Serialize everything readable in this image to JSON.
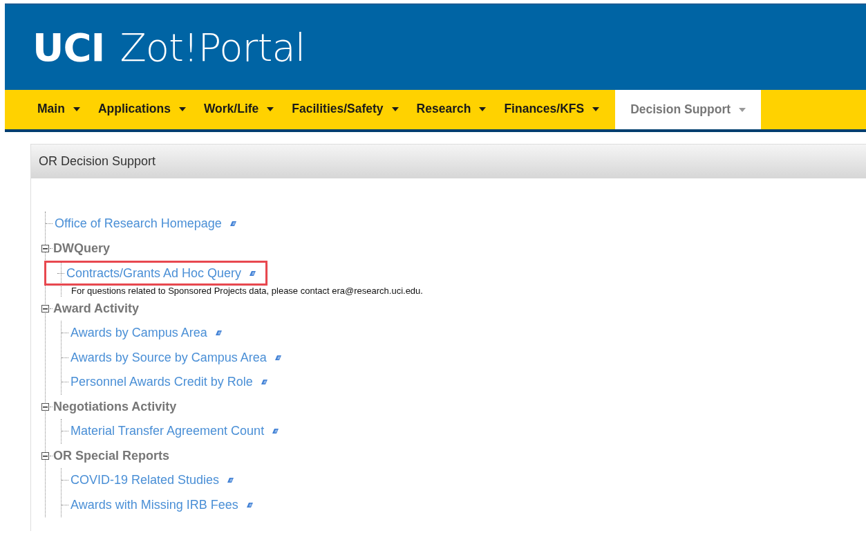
{
  "header": {
    "logo_bold": "UCI",
    "logo_text": "Zot!Portal"
  },
  "nav": [
    {
      "label": "Main",
      "selected": false
    },
    {
      "label": "Applications",
      "selected": false
    },
    {
      "label": "Work/Life",
      "selected": false
    },
    {
      "label": "Facilities/Safety",
      "selected": false
    },
    {
      "label": "Research",
      "selected": false
    },
    {
      "label": "Finances/KFS",
      "selected": false
    },
    {
      "label": "Decision Support",
      "selected": true
    }
  ],
  "panel": {
    "title": "OR Decision Support",
    "tree": [
      {
        "kind": "link",
        "label": "Office of Research Homepage"
      },
      {
        "kind": "group",
        "label": "DWQuery",
        "expanded": true,
        "children": [
          {
            "kind": "link",
            "label": "Contracts/Grants Ad Hoc Query",
            "highlighted": true,
            "note": "For questions related to Sponsored Projects data, please contact era@research.uci.edu."
          }
        ]
      },
      {
        "kind": "group",
        "label": "Award Activity",
        "expanded": true,
        "children": [
          {
            "kind": "link",
            "label": "Awards by Campus Area",
            "highlighted": false
          },
          {
            "kind": "link",
            "label": "Awards by Source by Campus Area",
            "highlighted": false
          },
          {
            "kind": "link",
            "label": "Personnel Awards Credit by Role",
            "highlighted": false
          }
        ]
      },
      {
        "kind": "group",
        "label": "Negotiations Activity",
        "expanded": true,
        "children": [
          {
            "kind": "link",
            "label": "Material Transfer Agreement Count",
            "highlighted": false
          }
        ]
      },
      {
        "kind": "group",
        "label": "OR Special Reports",
        "expanded": true,
        "children": [
          {
            "kind": "link",
            "label": "COVID-19 Related Studies",
            "highlighted": false
          },
          {
            "kind": "link",
            "label": "Awards with Missing IRB Fees",
            "highlighted": false
          }
        ]
      }
    ]
  }
}
